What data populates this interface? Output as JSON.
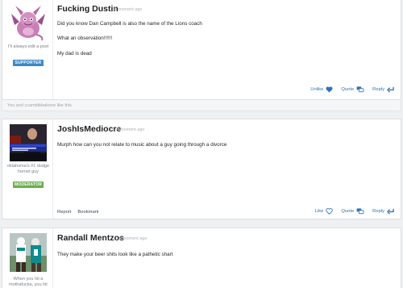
{
  "posts": [
    {
      "username": "Fucking Dustin",
      "time": "A moment ago",
      "user_title": "I'll always edit a post",
      "badge": "SUPPORTER",
      "lines": [
        "Did you know Dan Campbell is also the name of the Lions coach",
        "What an observation!!!!!!",
        "My dad is dead"
      ],
      "actions": {
        "like": "Unlike",
        "quote": "Quote",
        "reply": "Reply"
      },
      "likes_text": "You and ccambibbakone like this."
    },
    {
      "username": "JoshIsMediocre",
      "time": "A moment ago",
      "user_title": "oklahoma's #1 dodge hornet guy",
      "badge": "MODERATOR",
      "lines": [
        "Murph how can you not relate to music about a guy going through a divorce"
      ],
      "left_actions": {
        "report": "Report",
        "bookmark": "Bookmark"
      },
      "actions": {
        "like": "Like",
        "quote": "Quote",
        "reply": "Reply"
      }
    },
    {
      "username": "Randall Mentzos",
      "time": "A moment ago",
      "user_title": "When you hit a mothafucka, you hit",
      "lines": [
        "They make your beer shits look like a pathetic shart"
      ]
    }
  ],
  "colors": {
    "link": "#2d72b8",
    "supporter": "#3d86c6",
    "moderator": "#6ab04c"
  },
  "icons": [
    "heart-icon",
    "quote-bubble-icon",
    "reply-arrow-icon"
  ]
}
